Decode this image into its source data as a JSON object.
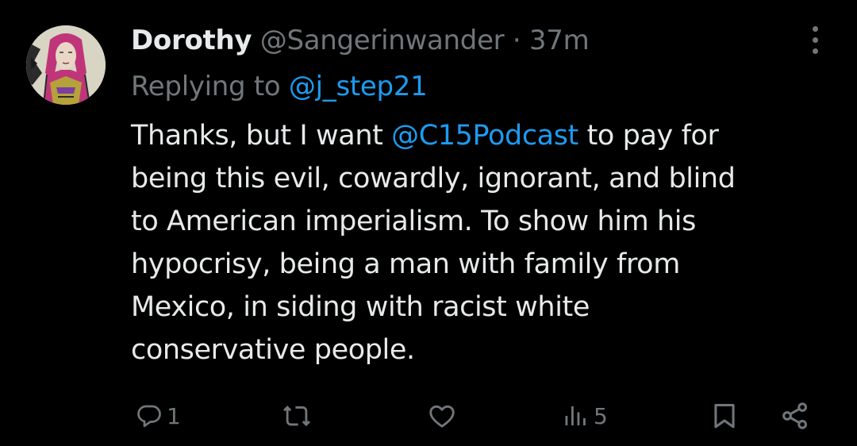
{
  "tweet": {
    "author": {
      "name": "Dorothy",
      "handle": "@Sangerinwander",
      "separator": "·",
      "time": "37m",
      "avatar_icon": "illustrated-woman-avatar"
    },
    "replying": {
      "prefix": "Replying to",
      "mention": "@j_step21"
    },
    "body": {
      "line1_before": "Thanks, but I want",
      "line1_mention": "@C15Podcast",
      "line1_after": "to pay for",
      "line2": "being this evil, cowardly, ignorant, and blind",
      "line3": "to American imperialism. To show him his",
      "line4": "hypocrisy, being a man with family from",
      "line5": "Mexico, in siding with racist white",
      "line6": "conservative people."
    },
    "actions": {
      "reply": {
        "icon": "reply-icon",
        "count": "1"
      },
      "retweet": {
        "icon": "retweet-icon",
        "count": ""
      },
      "like": {
        "icon": "heart-icon",
        "count": ""
      },
      "views": {
        "icon": "views-icon",
        "count": "5"
      },
      "bookmark": {
        "icon": "bookmark-icon"
      },
      "share": {
        "icon": "share-icon"
      }
    },
    "more_icon": "more-vertical-icon"
  },
  "colors": {
    "background": "#000000",
    "text_primary": "#e7e9ea",
    "text_secondary": "#71767b",
    "link": "#1d9bf0"
  }
}
